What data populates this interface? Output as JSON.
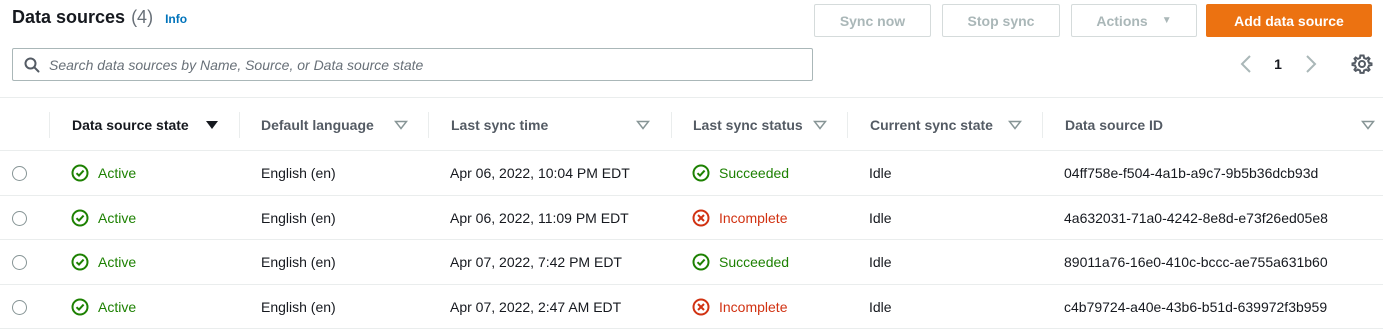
{
  "header": {
    "title": "Data sources",
    "count": "(4)",
    "info": "Info"
  },
  "toolbar": {
    "sync_now": "Sync now",
    "stop_sync": "Stop sync",
    "actions": "Actions",
    "add_data_source": "Add data source"
  },
  "search": {
    "placeholder": "Search data sources by Name, Source, or Data source state",
    "value": ""
  },
  "pagination": {
    "current_page": "1"
  },
  "colors": {
    "accent": "#ec7211",
    "success": "#1d8102",
    "error": "#d13212",
    "link": "#0073bb"
  },
  "table": {
    "columns": [
      {
        "label": "Data source state",
        "sorted": true
      },
      {
        "label": "Default language",
        "sorted": false
      },
      {
        "label": "Last sync time",
        "sorted": false
      },
      {
        "label": "Last sync status",
        "sorted": false
      },
      {
        "label": "Current sync state",
        "sorted": false
      },
      {
        "label": "Data source ID",
        "sorted": false
      }
    ],
    "rows": [
      {
        "state": "Active",
        "language": "English (en)",
        "last_sync_time": "Apr 06, 2022, 10:04 PM EDT",
        "last_sync_status": "Succeeded",
        "status_icon": "check-circle-icon",
        "current_sync_state": "Idle",
        "id": "04ff758e-f504-4a1b-a9c7-9b5b36dcb93d"
      },
      {
        "state": "Active",
        "language": "English (en)",
        "last_sync_time": "Apr 06, 2022, 11:09 PM EDT",
        "last_sync_status": "Incomplete",
        "status_icon": "error-circle-icon",
        "current_sync_state": "Idle",
        "id": "4a632031-71a0-4242-8e8d-e73f26ed05e8"
      },
      {
        "state": "Active",
        "language": "English (en)",
        "last_sync_time": "Apr 07, 2022, 7:42 PM EDT",
        "last_sync_status": "Succeeded",
        "status_icon": "check-circle-icon",
        "current_sync_state": "Idle",
        "id": "89011a76-16e0-410c-bccc-ae755a631b60"
      },
      {
        "state": "Active",
        "language": "English (en)",
        "last_sync_time": "Apr 07, 2022, 2:47 AM EDT",
        "last_sync_status": "Incomplete",
        "status_icon": "error-circle-icon",
        "current_sync_state": "Idle",
        "id": "c4b79724-a40e-43b6-b51d-639972f3b959"
      }
    ]
  }
}
